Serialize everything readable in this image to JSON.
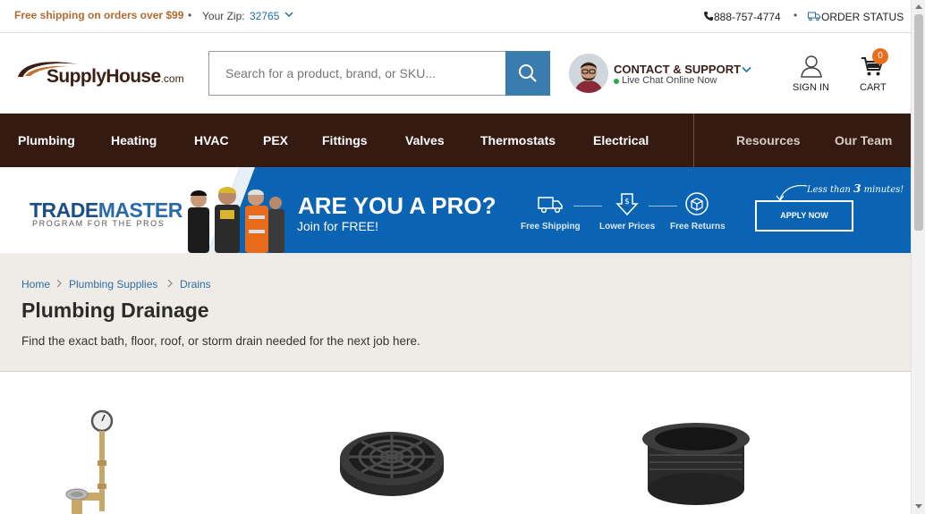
{
  "topbar": {
    "shipping_promo": "Free shipping on orders over $99",
    "separator": "•",
    "zip_label": "Your Zip:",
    "zip_value": "32765",
    "phone": "888-757-4774",
    "order_status": "ORDER STATUS"
  },
  "header": {
    "logo_main": "SupplyHouse",
    "logo_suffix": ".com",
    "search_placeholder": "Search for a product, brand, or SKU...",
    "contact_title": "CONTACT & SUPPORT",
    "chat_status": "Live Chat Online Now",
    "signin_label": "SIGN IN",
    "cart_label": "CART",
    "cart_count": "0"
  },
  "nav": {
    "items": [
      "Plumbing",
      "Heating",
      "HVAC",
      "PEX",
      "Fittings",
      "Valves",
      "Thermostats",
      "Electrical"
    ],
    "secondary": [
      "Resources",
      "Our Team"
    ]
  },
  "banner": {
    "brand_main": "TRADE",
    "brand_accent": "MASTER",
    "brand_sub": "PROGRAM FOR THE PROS",
    "headline": "ARE YOU A PRO?",
    "subline": "Join for FREE!",
    "perks": [
      "Free Shipping",
      "Lower Prices",
      "Free Returns"
    ],
    "cta_label": "APPLY NOW",
    "cta_note_prefix": "Less than",
    "cta_note_num": "3",
    "cta_note_suffix": "minutes!"
  },
  "category": {
    "breadcrumb": [
      "Home",
      "Plumbing Supplies",
      "Drains"
    ],
    "title": "Plumbing Drainage",
    "description": "Find the exact bath, floor, roof, or storm drain needed for the next job here."
  },
  "colors": {
    "nav_bg": "#351a12",
    "accent_blue": "#3a7cad",
    "promo_orange": "#b4692f",
    "banner_blue": "#0a63b3",
    "cart_badge": "#e76f1e"
  }
}
